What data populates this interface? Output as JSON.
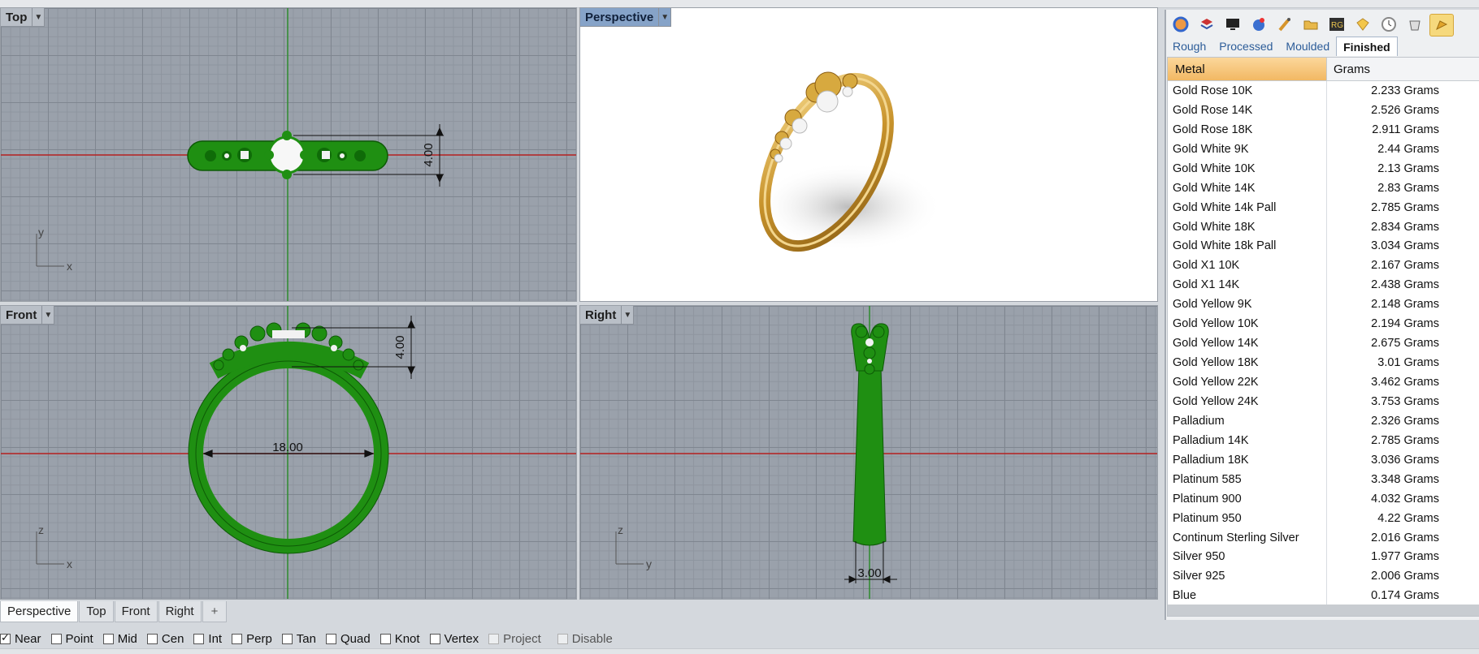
{
  "viewports": {
    "top": {
      "label": "Top",
      "dimension": "4.00",
      "axis_v": "y",
      "axis_h": "x"
    },
    "perspective": {
      "label": "Perspective"
    },
    "front": {
      "label": "Front",
      "dimension_small": "4.00",
      "dimension_width": "18.00",
      "axis_v": "z",
      "axis_h": "x"
    },
    "right": {
      "label": "Right",
      "dimension": "3.00",
      "axis_v": "z",
      "axis_h": "y"
    }
  },
  "viewport_tabs": [
    "Perspective",
    "Top",
    "Front",
    "Right",
    "+"
  ],
  "osnaps": [
    {
      "label": "Near",
      "checked": true,
      "disabled": false
    },
    {
      "label": "Point",
      "checked": false,
      "disabled": false
    },
    {
      "label": "Mid",
      "checked": false,
      "disabled": false
    },
    {
      "label": "Cen",
      "checked": false,
      "disabled": false
    },
    {
      "label": "Int",
      "checked": false,
      "disabled": false
    },
    {
      "label": "Perp",
      "checked": false,
      "disabled": false
    },
    {
      "label": "Tan",
      "checked": false,
      "disabled": false
    },
    {
      "label": "Quad",
      "checked": false,
      "disabled": false
    },
    {
      "label": "Knot",
      "checked": false,
      "disabled": false
    },
    {
      "label": "Vertex",
      "checked": false,
      "disabled": false
    },
    {
      "label": "Project",
      "checked": false,
      "disabled": true
    },
    {
      "label": "Disable",
      "checked": false,
      "disabled": true
    }
  ],
  "panel": {
    "icons": [
      "color-wheel-icon",
      "layers-icon",
      "display-icon",
      "materials-icon",
      "brush-icon",
      "folder-icon",
      "rg-icon",
      "gem-icon",
      "clock-icon",
      "bucket-icon",
      "weight-icon"
    ],
    "tabs": [
      "Rough",
      "Processed",
      "Moulded",
      "Finished"
    ],
    "active_tab": "Finished",
    "columns": [
      "Metal",
      "Grams"
    ],
    "rows": [
      [
        "Gold Rose 10K",
        "2.233 Grams"
      ],
      [
        "Gold Rose 14K",
        "2.526 Grams"
      ],
      [
        "Gold Rose 18K",
        "2.911 Grams"
      ],
      [
        "Gold White 9K",
        "2.44 Grams"
      ],
      [
        "Gold White 10K",
        "2.13 Grams"
      ],
      [
        "Gold White 14K",
        "2.83 Grams"
      ],
      [
        "Gold White 14k Pall",
        "2.785 Grams"
      ],
      [
        "Gold White 18K",
        "2.834 Grams"
      ],
      [
        "Gold White 18k Pall",
        "3.034 Grams"
      ],
      [
        "Gold X1 10K",
        "2.167 Grams"
      ],
      [
        "Gold X1 14K",
        "2.438 Grams"
      ],
      [
        "Gold Yellow 9K",
        "2.148 Grams"
      ],
      [
        "Gold Yellow 10K",
        "2.194 Grams"
      ],
      [
        "Gold Yellow 14K",
        "2.675 Grams"
      ],
      [
        "Gold Yellow 18K",
        "3.01 Grams"
      ],
      [
        "Gold Yellow 22K",
        "3.462 Grams"
      ],
      [
        "Gold Yellow 24K",
        "3.753 Grams"
      ],
      [
        "Palladium",
        "2.326 Grams"
      ],
      [
        "Palladium 14K",
        "2.785 Grams"
      ],
      [
        "Palladium 18K",
        "3.036 Grams"
      ],
      [
        "Platinum 585",
        "3.348 Grams"
      ],
      [
        "Platinum 900",
        "4.032 Grams"
      ],
      [
        "Platinum 950",
        "4.22 Grams"
      ],
      [
        "Continum Sterling Silver",
        "2.016 Grams"
      ],
      [
        "Silver 950",
        "1.977 Grams"
      ],
      [
        "Silver 925",
        "2.006 Grams"
      ],
      [
        "Blue",
        "0.174 Grams"
      ]
    ]
  },
  "colors": {
    "model_green": "#1f8f12",
    "viewport_grey": "#9aa1ab",
    "x_axis_red": "#b52020",
    "y_axis_green": "#2e8b2e",
    "active_label": "#86a3c8",
    "gold": "#d7a93f"
  }
}
